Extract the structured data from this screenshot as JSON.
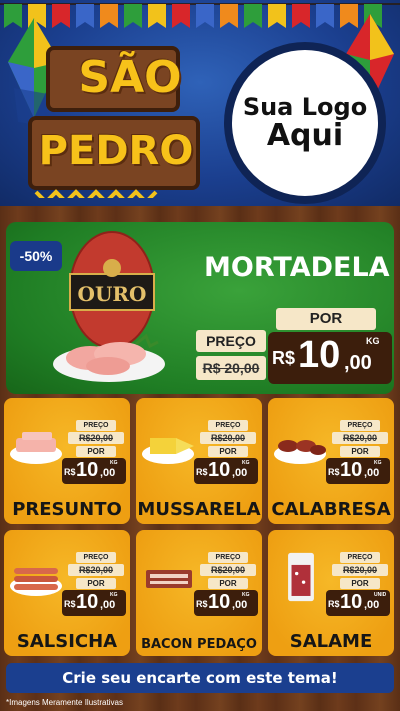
{
  "header": {
    "title_line1": "SÃO",
    "title_line2": "PEDRO",
    "logo_line1": "Sua Logo",
    "logo_line2": "Aqui"
  },
  "featured": {
    "discount": "-50%",
    "name": "MORTADELA",
    "brand_text": "OURO",
    "price_label": "PREÇO",
    "old_price": "R$ 20,00",
    "por_label": "POR",
    "currency": "R$",
    "price_int": "10",
    "price_dec": ",00",
    "unit": "KG"
  },
  "products": [
    {
      "name": "PRESUNTO",
      "price_label": "PREÇO",
      "old_price": "R$20,00",
      "por_label": "POR",
      "currency": "R$",
      "price_int": "10",
      "price_dec": ",00",
      "unit": "KG"
    },
    {
      "name": "MUSSARELA",
      "price_label": "PREÇO",
      "old_price": "R$20,00",
      "por_label": "POR",
      "currency": "R$",
      "price_int": "10",
      "price_dec": ",00",
      "unit": "KG"
    },
    {
      "name": "CALABRESA",
      "price_label": "PREÇO",
      "old_price": "R$20,00",
      "por_label": "POR",
      "currency": "R$",
      "price_int": "10",
      "price_dec": ",00",
      "unit": "KG"
    },
    {
      "name": "SALSICHA",
      "price_label": "PREÇO",
      "old_price": "R$20,00",
      "por_label": "POR",
      "currency": "R$",
      "price_int": "10",
      "price_dec": ",00",
      "unit": "KG"
    },
    {
      "name": "BACON PEDAÇO",
      "price_label": "PREÇO",
      "old_price": "R$20,00",
      "por_label": "POR",
      "currency": "R$",
      "price_int": "10",
      "price_dec": ",00",
      "unit": "KG"
    },
    {
      "name": "SALAME",
      "price_label": "PREÇO",
      "old_price": "R$20,00",
      "por_label": "POR",
      "currency": "R$",
      "price_int": "10",
      "price_dec": ",00",
      "unit": "UNID"
    }
  ],
  "cta": "Crie seu encarte com este tema!",
  "footnote": "*Imagens Meramente Ilustrativas",
  "colors": {
    "accent_blue": "#1b3f8f",
    "card_orange": "#f2a91c",
    "green": "#1f7d24",
    "wood": "#6b3b1e"
  }
}
